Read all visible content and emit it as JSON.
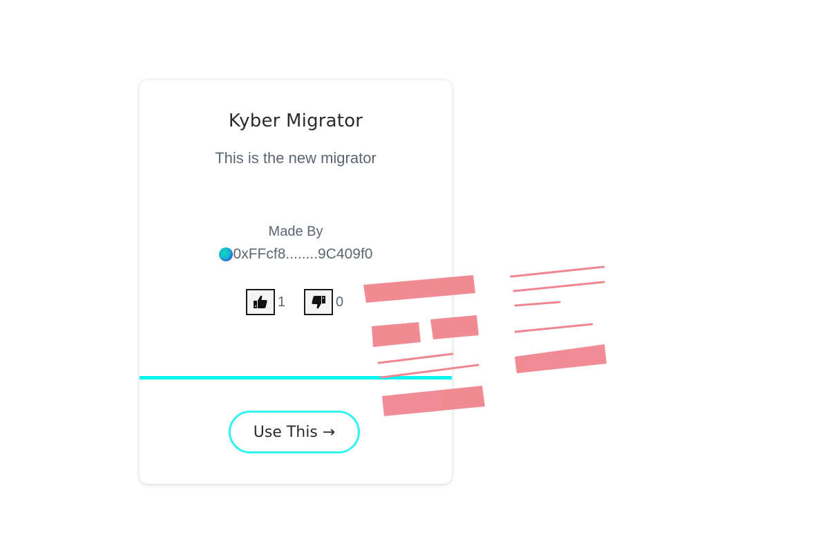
{
  "card": {
    "title": "Kyber Migrator",
    "description": "This is the new migrator",
    "made_by_label": "Made By",
    "address": "0xFFcf8........9C409f0",
    "upvotes": "1",
    "downvotes": "0",
    "use_button_label": "Use This →"
  },
  "icons": {
    "avatar": "avatar-icon",
    "upvote": "thumbs-up-icon",
    "downvote": "thumbs-down-icon"
  },
  "colors": {
    "accent": "#00f5ef",
    "button_border": "#2ef3ee",
    "redaction": "#f0858f"
  }
}
